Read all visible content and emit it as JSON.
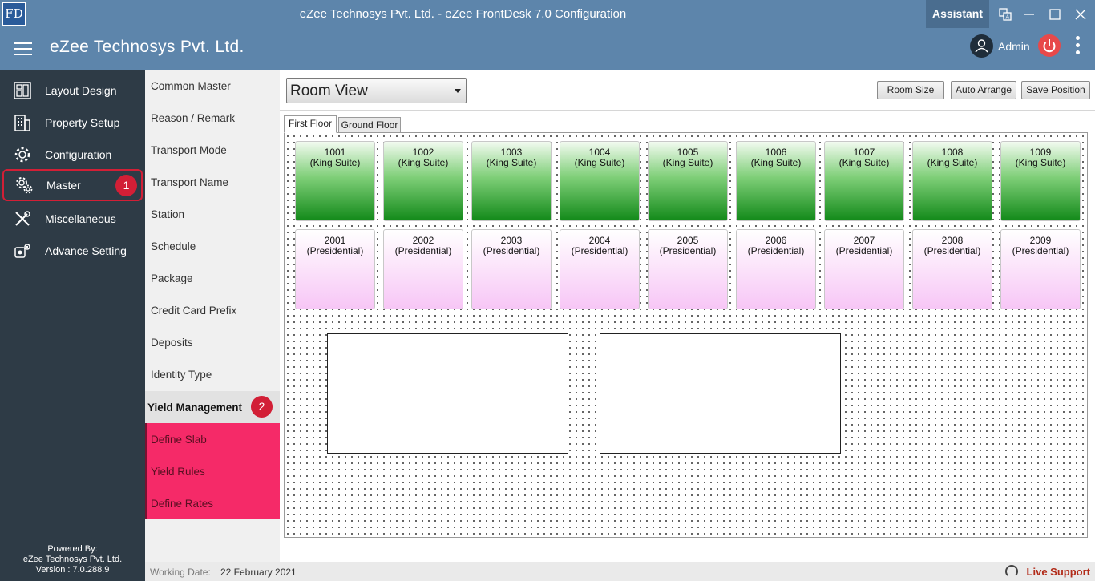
{
  "window": {
    "logo_text": "FD",
    "title": "eZee Technosys Pvt. Ltd. - eZee FrontDesk 7.0 Configuration",
    "assistant_label": "Assistant",
    "controls": [
      "translate-icon",
      "minimize-icon",
      "maximize-icon",
      "close-icon"
    ]
  },
  "header": {
    "company": "eZee Technosys Pvt. Ltd.",
    "user": "Admin"
  },
  "sidebar": {
    "items": [
      {
        "label": "Layout Design",
        "icon": "layout-icon"
      },
      {
        "label": "Property Setup",
        "icon": "building-icon"
      },
      {
        "label": "Configuration",
        "icon": "gear-icon"
      },
      {
        "label": "Master",
        "icon": "master-gear-icon",
        "active": true,
        "step": "1"
      },
      {
        "label": "Miscellaneous",
        "icon": "tools-icon"
      },
      {
        "label": "Advance Setting",
        "icon": "advance-gear-icon"
      }
    ],
    "powered_by": "Powered By:",
    "powered_company": "eZee Technosys Pvt. Ltd.",
    "version": "Version : 7.0.288.9"
  },
  "submenu": {
    "items": [
      "Common Master",
      "Reason / Remark",
      "Transport Mode",
      "Transport Name",
      "Station",
      "Schedule",
      "Package",
      "Credit Card Prefix",
      "Deposits",
      "Identity Type"
    ],
    "group_header": "Yield Management",
    "group_step": "2",
    "group_items": [
      "Define Slab",
      "Yield Rules",
      "Define Rates"
    ]
  },
  "toolbar": {
    "view_select": "Room View",
    "room_size_label": "Room Size",
    "auto_arrange_label": "Auto Arrange",
    "save_position_label": "Save Position"
  },
  "tabs": [
    "First Floor",
    "Ground Floor"
  ],
  "rooms": {
    "row1": [
      {
        "number": "1001",
        "type": "(King Suite)"
      },
      {
        "number": "1002",
        "type": "(King Suite)"
      },
      {
        "number": "1003",
        "type": "(King Suite)"
      },
      {
        "number": "1004",
        "type": "(King Suite)"
      },
      {
        "number": "1005",
        "type": "(King Suite)"
      },
      {
        "number": "1006",
        "type": "(King Suite)"
      },
      {
        "number": "1007",
        "type": "(King Suite)"
      },
      {
        "number": "1008",
        "type": "(King Suite)"
      },
      {
        "number": "1009",
        "type": "(King Suite)"
      }
    ],
    "row2": [
      {
        "number": "2001",
        "type": "(Presidential)"
      },
      {
        "number": "2002",
        "type": "(Presidential)"
      },
      {
        "number": "2003",
        "type": "(Presidential)"
      },
      {
        "number": "2004",
        "type": "(Presidential)"
      },
      {
        "number": "2005",
        "type": "(Presidential)"
      },
      {
        "number": "2006",
        "type": "(Presidential)"
      },
      {
        "number": "2007",
        "type": "(Presidential)"
      },
      {
        "number": "2008",
        "type": "(Presidential)"
      },
      {
        "number": "2009",
        "type": "(Presidential)"
      }
    ]
  },
  "statusbar": {
    "working_date_label": "Working Date:",
    "working_date": "22 February 2021",
    "live_support": "Live Support"
  },
  "colors": {
    "titlebar": "#5d85ab",
    "sidebar": "#2e3b46",
    "accent_red": "#d21f36",
    "pink_menu": "#f52a68",
    "room_green": "#138a1a",
    "room_pink": "#f7c6f6"
  }
}
